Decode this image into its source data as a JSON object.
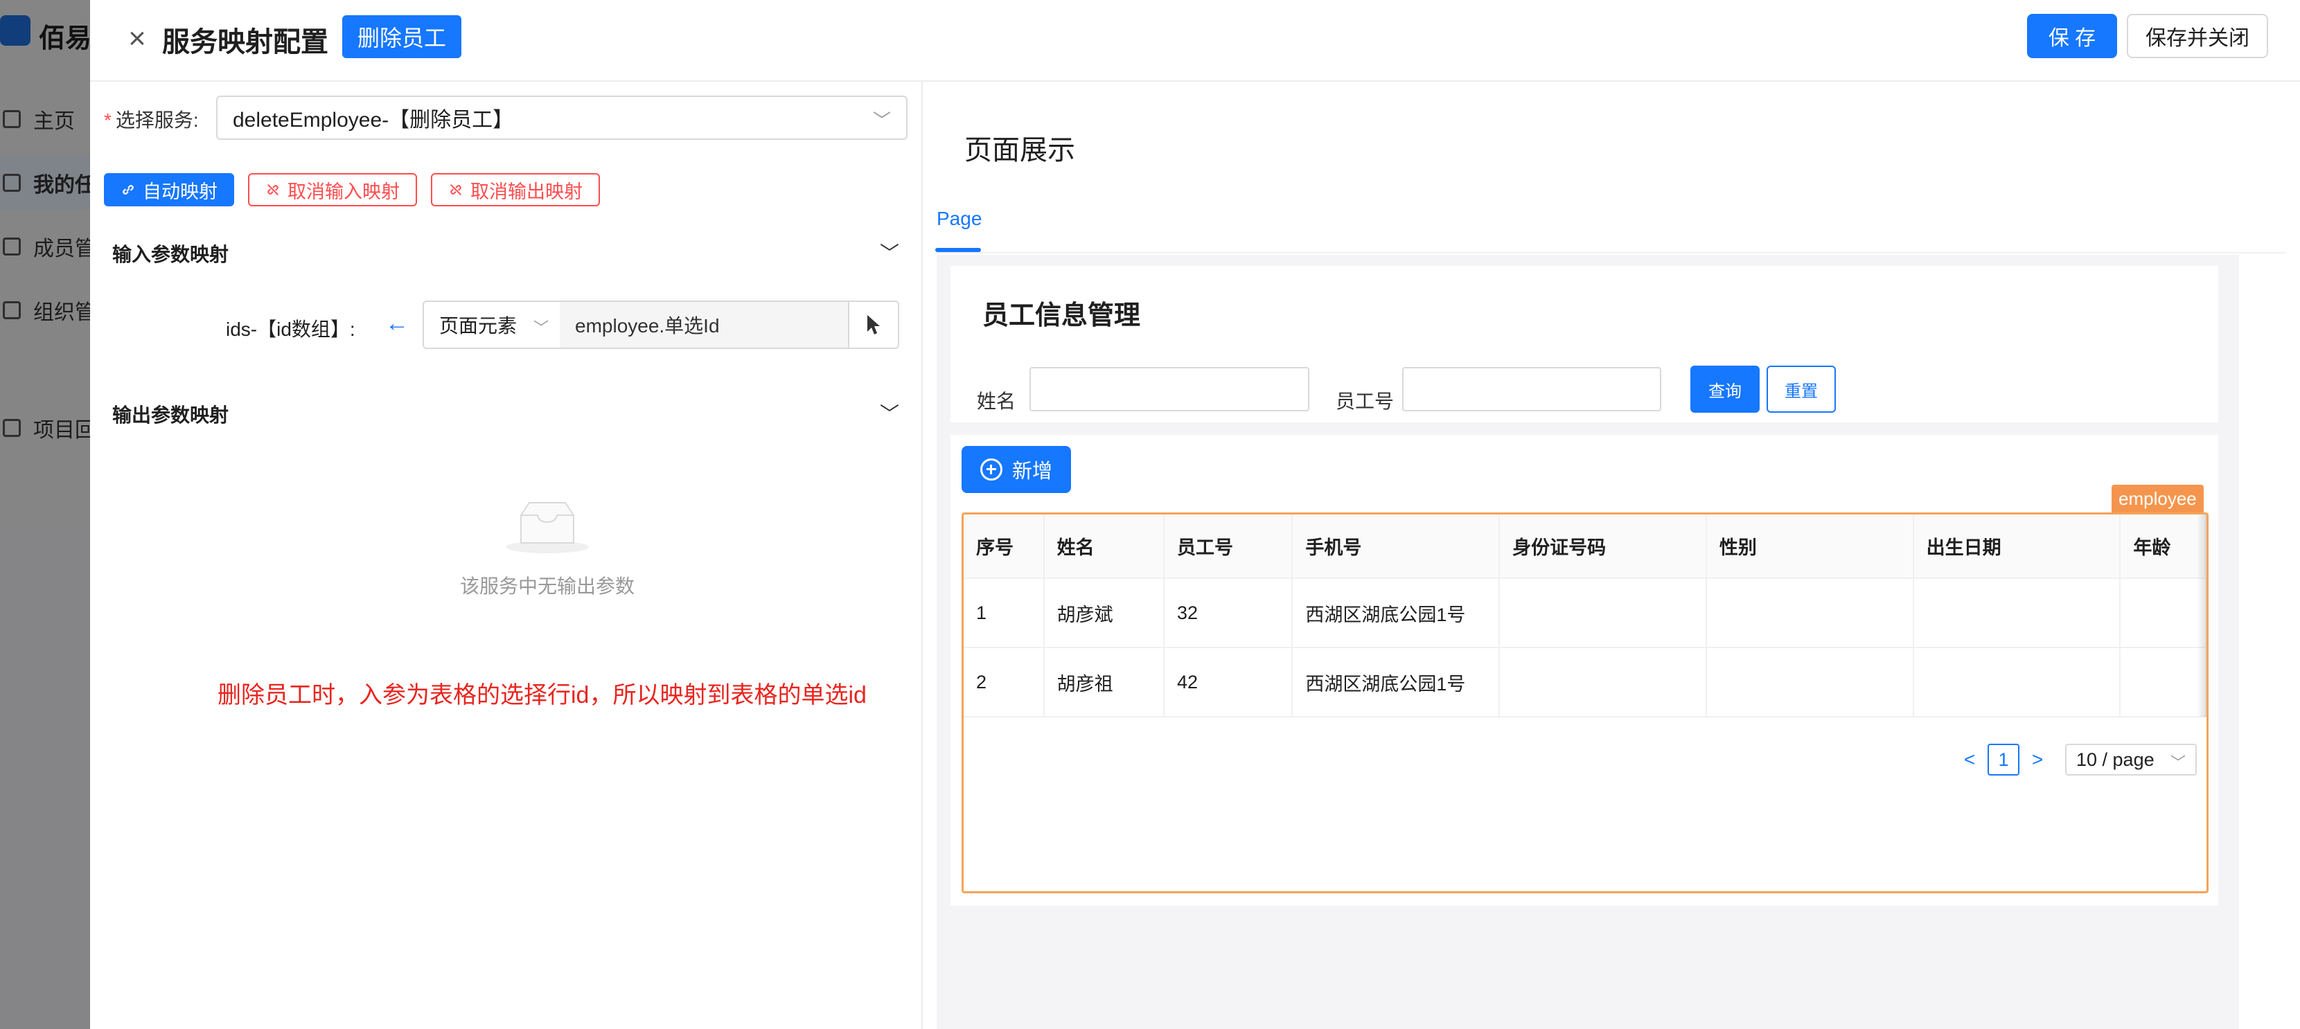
{
  "background": {
    "brand": "佰易",
    "menu": [
      {
        "label": "主页",
        "icon": "home-icon"
      },
      {
        "label": "我的任",
        "icon": "file-icon",
        "active": true
      },
      {
        "label": "成员管",
        "icon": "user-icon"
      },
      {
        "label": "组织管",
        "icon": "org-icon"
      },
      {
        "label": "项目回",
        "icon": "trash-icon"
      }
    ]
  },
  "drawer": {
    "title": "服务映射配置",
    "tag": "删除员工",
    "save_label": "保 存",
    "save_close_label": "保存并关闭"
  },
  "left": {
    "service_label": "选择服务:",
    "service_value": "deleteEmployee-【删除员工】",
    "auto_map_label": "自动映射",
    "cancel_input_label": "取消输入映射",
    "cancel_output_label": "取消输出映射",
    "input_section": "输入参数映射",
    "output_section": "输出参数映射",
    "param_label": "ids-【id数组】:",
    "source_type": "页面元素",
    "source_value": "employee.单选Id",
    "empty_text": "该服务中无输出参数",
    "annotation": "删除员工时，入参为表格的选择行id，所以映射到表格的单选id"
  },
  "right": {
    "preview_title": "页面展示",
    "tab_label": "Page",
    "page_title": "员工信息管理",
    "filters": [
      {
        "label": "姓名",
        "placeholder": ""
      },
      {
        "label": "员工号",
        "placeholder": ""
      }
    ],
    "query_label": "查询",
    "reset_label": "重置",
    "add_label": "新增",
    "table_tag": "employee",
    "columns": [
      "序号",
      "姓名",
      "员工号",
      "手机号",
      "身份证号码",
      "性别",
      "出生日期",
      "年龄"
    ],
    "rows": [
      [
        "1",
        "胡彦斌",
        "32",
        "西湖区湖底公园1号",
        "",
        "",
        "",
        ""
      ],
      [
        "2",
        "胡彦祖",
        "42",
        "西湖区湖底公园1号",
        "",
        "",
        "",
        ""
      ]
    ],
    "pagination": {
      "prev": "<",
      "current": "1",
      "next": ">",
      "page_size": "10 / page"
    }
  },
  "colors": {
    "primary": "#1677ff",
    "danger": "#ff4d4f",
    "annotation": "#e8251f",
    "table_highlight": "#f5a35a",
    "tag_orange": "#f5954d"
  }
}
